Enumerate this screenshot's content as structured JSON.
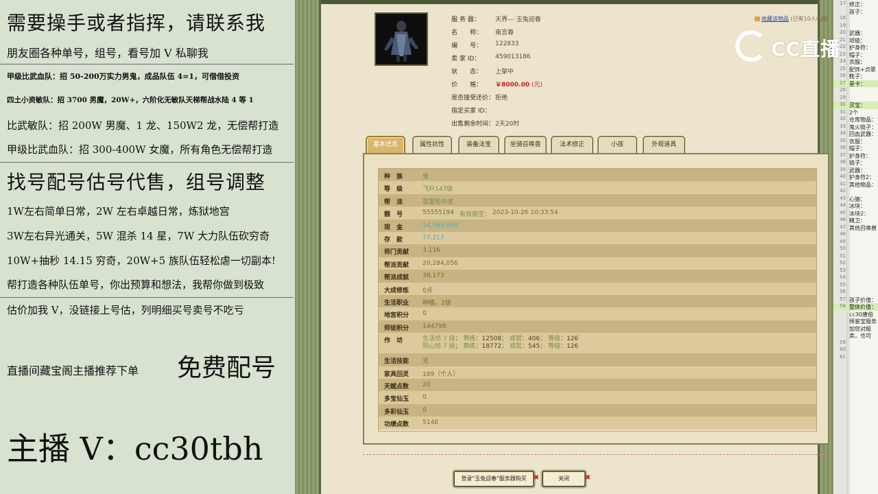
{
  "left_panel": {
    "lines": [
      "需要操手或者指挥，请联系我",
      "朋友圈各种单号，组号，看号加 V 私聊我",
      "甲级比武血队：招 50-200万实力男鬼，成品队伍 4=1，可借借投资",
      "四土小资敏队：招 3700 男魔，20W+，六阶化无敏队天梯帮战水陆 4 等 1",
      "比武敏队：招 200W 男魔、1 龙、150W2 龙，无偿帮打造",
      "甲级比武血队：招 300-400W 女魔，所有角色无偿帮打造",
      "找号配号估号代售，组号调整",
      "1W左右简单日常，2W 左右卓越日常，炼狱地宫",
      "3W左右异光通关，5W 混杀 14 星，7W 大力队伍砍穷奇",
      "10W+抽秒 14.15 穷奇，20W+5 族队伍轻松虐一切副本!",
      "帮打造各种队伍单号，你出预算和想法，我帮你做到极致",
      "估价加我 V，没链接上号估，列明细买号卖号不吃亏",
      "直播间藏宝阁主播推荐下单",
      "免费配号",
      "主播 V：cc30tbh"
    ]
  },
  "game": {
    "info": {
      "server_label": "服 务 器：",
      "server": "天界--- 玉兔迎春",
      "name_label": "名　　称：",
      "name": "南宫春",
      "id_label": "编　　号：",
      "id": "122833",
      "seller_label": "卖  家  ID：",
      "seller": "459013186",
      "status_label": "状　　态：",
      "status": "上架中",
      "price_label": "价　　格：",
      "price": "￥8000.00",
      "price_unit": "(元)",
      "counter_label": "是否接受还价：",
      "counter": "拒绝",
      "buyer_label": "指定买家 ID：",
      "buyer": "",
      "remain_label": "出售剩余时间：",
      "remain": "2天20时"
    },
    "favorite": {
      "link": "收藏该物品",
      "count_text": "(已有10人收藏)"
    },
    "tabs": [
      "基本信息",
      "属性抗性",
      "装备法宝",
      "坐骑召唤兽",
      "法术修正",
      "小孩",
      "外观道具"
    ],
    "active_tab": 0,
    "rows": [
      {
        "k": "种　族",
        "v": "鬼",
        "style": "g"
      },
      {
        "k": "等　级",
        "v": "飞升147级",
        "style": "g"
      },
      {
        "k": "帮　派",
        "v": "需要险中求",
        "style": "g"
      },
      {
        "k": "靓　号",
        "v": "55555194",
        "extra_label": "有效期至：",
        "extra": "2023-10-26 10:33:54",
        "style": "y"
      },
      {
        "k": "现　金",
        "v": "54,989,999",
        "style": "c"
      },
      {
        "k": "存　款",
        "v": "77,217",
        "style": "c"
      },
      {
        "k": "师门贡献",
        "v": "3,116",
        "style": "y"
      },
      {
        "k": "帮派贡献",
        "v": "20,284,056",
        "style": "y"
      },
      {
        "k": "帮派成就",
        "v": "38,173",
        "style": "y"
      },
      {
        "k": "大成修炼",
        "v": "0点",
        "style": "y"
      },
      {
        "k": "生活职业",
        "v": "种植，2级",
        "style": "y"
      },
      {
        "k": "地宫积分",
        "v": "0",
        "style": "y"
      },
      {
        "k": "师徒积分",
        "v": "144798",
        "style": "y"
      }
    ],
    "workshop": {
      "k": "作　坊",
      "line1": {
        "name": "生活坊 7 段",
        "a": "熟练：",
        "av": "12508",
        "b": "成就：",
        "bv": "406",
        "c": "等级：",
        "cv": "126"
      },
      "line2": {
        "name": "同心坊 7 段",
        "a": "熟练：",
        "av": "18772",
        "b": "成就：",
        "bv": "545",
        "c": "等级：",
        "cv": "126"
      }
    },
    "rows2": [
      {
        "k": "生活技能",
        "v": "无"
      },
      {
        "k": "家具回灵",
        "v": "189（个人）"
      },
      {
        "k": "天赋点数",
        "v": "20"
      },
      {
        "k": "多宝仙玉",
        "v": "0"
      },
      {
        "k": "多彩仙玉",
        "v": "0"
      },
      {
        "k": "功绩点数",
        "v": "5148"
      }
    ],
    "buttons": {
      "login": "登录\"玉兔迎春\"服务器购买",
      "close": "关闭"
    }
  },
  "watermark": "CC直播",
  "notes": [
    {
      "n": "17",
      "t": "修正："
    },
    {
      "n": "",
      "t": "孩子："
    },
    {
      "n": "18",
      "t": ""
    },
    {
      "n": "19",
      "t": ""
    },
    {
      "n": "20",
      "t": "武器："
    },
    {
      "n": "21",
      "t": "项链："
    },
    {
      "n": "22",
      "t": "护身符："
    },
    {
      "n": "23",
      "t": "帽子："
    },
    {
      "n": "24",
      "t": "衣服："
    },
    {
      "n": "25",
      "t": "配饰+点翠"
    },
    {
      "n": "26",
      "t": "靴子："
    },
    {
      "n": "27",
      "t": "星卡：",
      "hl": true
    },
    {
      "n": "28",
      "t": ""
    },
    {
      "n": "29",
      "t": ""
    },
    {
      "n": "30",
      "t": "灵宝：",
      "hl": true
    },
    {
      "n": "31",
      "t": "2个"
    },
    {
      "n": "32",
      "t": "仓库物品："
    },
    {
      "n": "33",
      "t": "鬼火链子："
    },
    {
      "n": "34",
      "t": "回血武器："
    },
    {
      "n": "35",
      "t": "衣服："
    },
    {
      "n": "36",
      "t": "帽子："
    },
    {
      "n": "37",
      "t": "护身符："
    },
    {
      "n": "38",
      "t": "链子："
    },
    {
      "n": "39",
      "t": "武器："
    },
    {
      "n": "40",
      "t": "护身符2："
    },
    {
      "n": "41",
      "t": "其他物品："
    },
    {
      "n": "42",
      "t": ""
    },
    {
      "n": "43",
      "t": "心猿："
    },
    {
      "n": "44",
      "t": "冰块："
    },
    {
      "n": "45",
      "t": "冰块2："
    },
    {
      "n": "46",
      "t": "精卫："
    },
    {
      "n": "47",
      "t": "其他召唤兽"
    },
    {
      "n": "48",
      "t": ""
    },
    {
      "n": "49",
      "t": ""
    },
    {
      "n": "50",
      "t": ""
    },
    {
      "n": "51",
      "t": ""
    },
    {
      "n": "52",
      "t": ""
    },
    {
      "n": "53",
      "t": ""
    },
    {
      "n": "54",
      "t": ""
    },
    {
      "n": "55",
      "t": ""
    },
    {
      "n": "56",
      "t": ""
    },
    {
      "n": "57",
      "t": "孩子价值："
    },
    {
      "n": "58",
      "t": "整体价值：",
      "hl": true
    },
    {
      "n": "",
      "t": "cc30唐伯"
    },
    {
      "n": "",
      "t": "择鉴宝服务"
    },
    {
      "n": "",
      "t": "加您对报"
    },
    {
      "n": "",
      "t": "卖，也可"
    },
    {
      "n": "59",
      "t": ""
    },
    {
      "n": "60",
      "t": ""
    },
    {
      "n": "61",
      "t": ""
    }
  ]
}
